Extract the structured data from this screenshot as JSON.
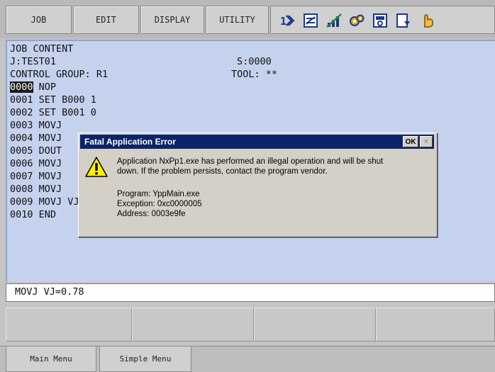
{
  "menu": {
    "tabs": [
      "JOB",
      "EDIT",
      "DISPLAY",
      "UTILITY"
    ],
    "icons": [
      "io-arrows-icon",
      "checklist-icon",
      "signal-bars-icon",
      "gears-icon",
      "tool-panel-icon",
      "save-document-icon",
      "hand-icon"
    ]
  },
  "job": {
    "heading": "JOB CONTENT",
    "name": "J:TEST01",
    "step": "S:0000",
    "control_group": "CONTROL GROUP: R1",
    "tool": "TOOL: **",
    "lines": [
      {
        "num": "0000",
        "text": " NOP"
      },
      {
        "num": "0001",
        "text": " SET B000 1"
      },
      {
        "num": "0002",
        "text": " SET B001 0"
      },
      {
        "num": "0003",
        "text": " MOVJ"
      },
      {
        "num": "0004",
        "text": " MOVJ"
      },
      {
        "num": "0005",
        "text": " DOUT"
      },
      {
        "num": "0006",
        "text": " MOVJ"
      },
      {
        "num": "0007",
        "text": " MOVJ"
      },
      {
        "num": "0008",
        "text": " MOVJ"
      },
      {
        "num": "0009",
        "text": " MOVJ VJ=100.00"
      },
      {
        "num": "0010",
        "text": " END"
      }
    ]
  },
  "input_line": "MOVJ VJ=0.78",
  "bottom": {
    "main_menu": "Main Menu",
    "simple_menu": "Simple Menu"
  },
  "dialog": {
    "title": "Fatal Application Error",
    "ok": "OK",
    "close": "×",
    "message_line1": "Application NxPp1.exe has performed an illegal operation and will be shut",
    "message_line2": "down.  If the problem persists, contact the program vendor.",
    "program": "Program: YppMain.exe",
    "exception": "Exception: 0xc0000005",
    "address": "Address: 0003e9fe",
    "icon": "warning-icon"
  },
  "colors": {
    "content_bg": "#c5d2ee",
    "titlebar": "#0a246a",
    "highlight": "#1a1a1a"
  }
}
